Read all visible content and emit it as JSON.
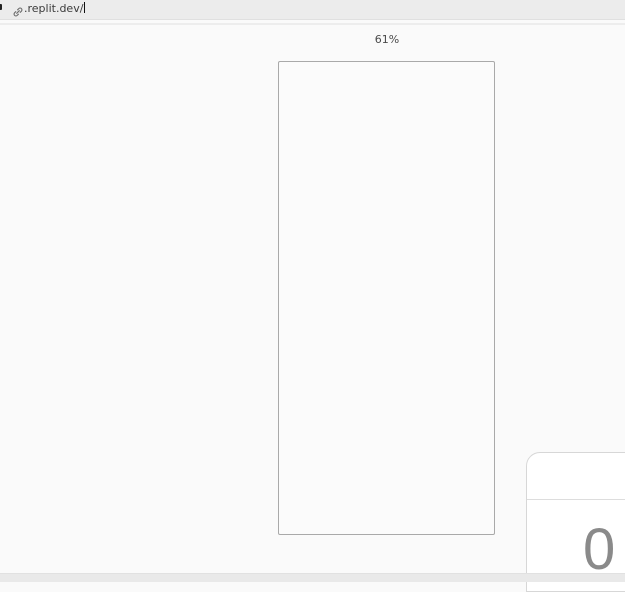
{
  "address_bar": {
    "url": ".replit.dev/",
    "link_icon": "link-icon"
  },
  "preview": {
    "zoom_level": "61%"
  },
  "panel": {
    "value": "0"
  }
}
